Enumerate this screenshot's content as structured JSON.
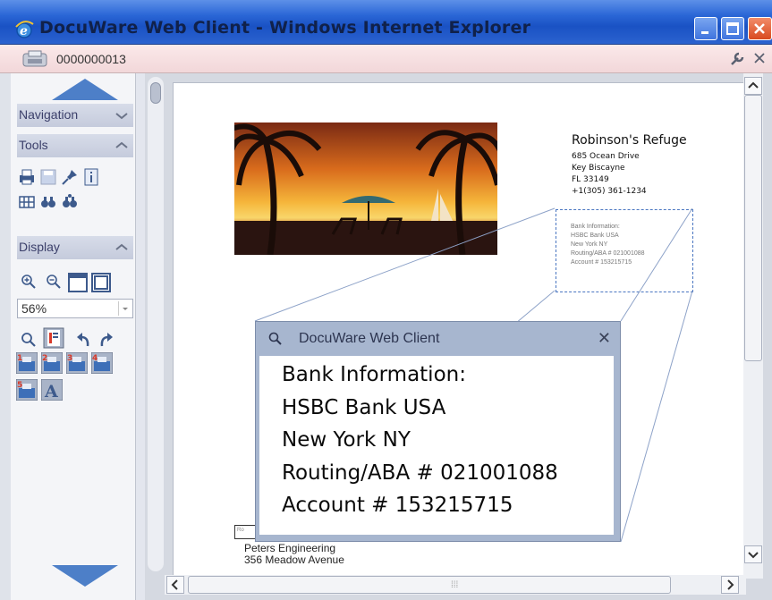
{
  "window": {
    "title": "DocuWare Web Client - Windows Internet Explorer"
  },
  "document_bar": {
    "doc_id": "0000000013"
  },
  "sidebar": {
    "sections": [
      {
        "label": "Navigation",
        "state": "collapsed"
      },
      {
        "label": "Tools",
        "state": "expanded"
      },
      {
        "label": "Display",
        "state": "expanded"
      }
    ],
    "zoom_value": "56%"
  },
  "document": {
    "letterhead": {
      "name": "Robinson's Refuge",
      "lines": [
        "685 Ocean Drive",
        "Key Biscayne",
        "FL 33149",
        "+1(305) 361-1234"
      ]
    },
    "bank_box": [
      "Bank Information:",
      "HSBC Bank USA",
      "New York NY",
      "Routing/ABA # 021001088",
      "Account # 153215715"
    ],
    "recipient": [
      "Peters Engineering",
      "356 Meadow Avenue"
    ],
    "recipient_tag": "Ro"
  },
  "magnifier": {
    "title": "DocuWare Web Client",
    "close": "✕",
    "lines": [
      "Bank Information:",
      "HSBC Bank USA",
      "New York NY",
      "Routing/ABA # 021001088",
      "Account # 153215715"
    ]
  },
  "colors": {
    "titlebar": "#2a66d6",
    "idbar": "#f2d7d9",
    "popup_frame": "#a7b6cf",
    "sidebar_header": "#c5cbdc"
  }
}
